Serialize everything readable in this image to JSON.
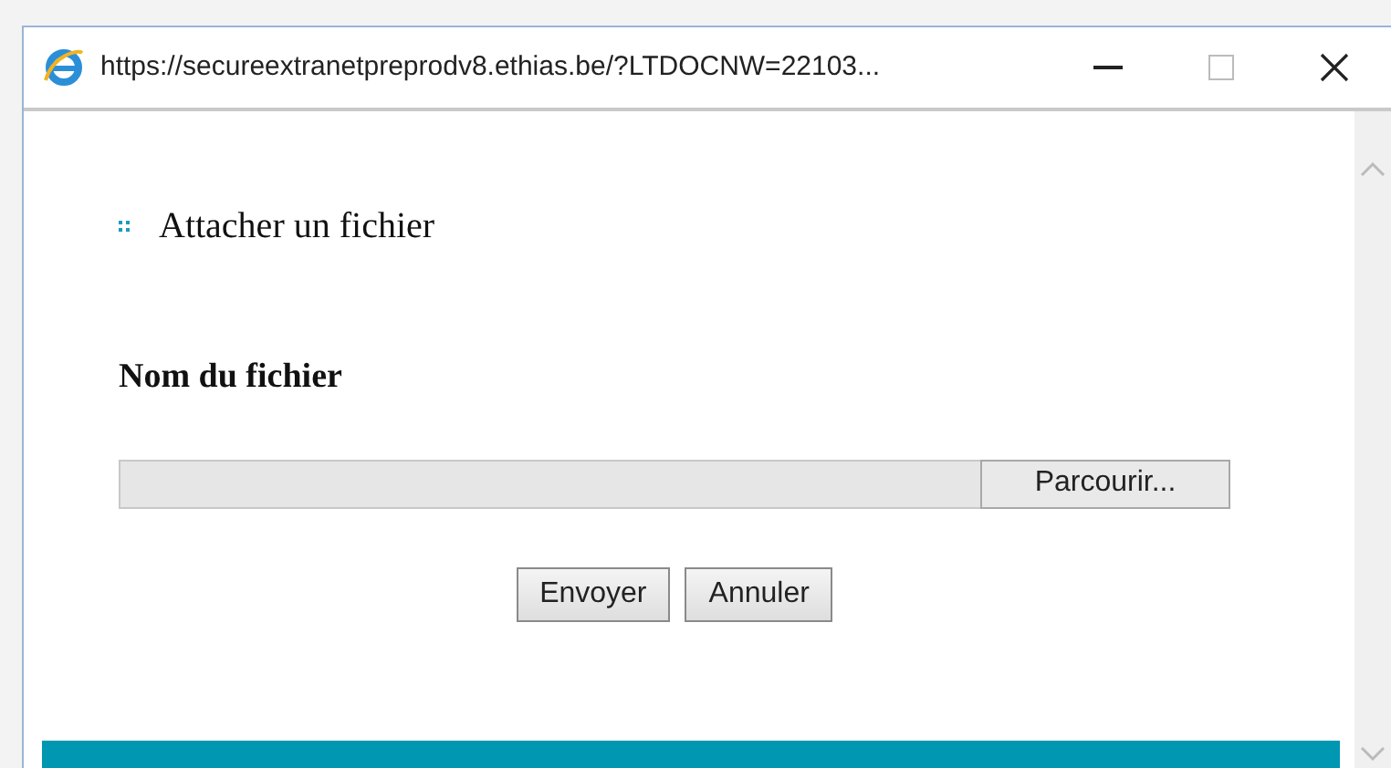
{
  "window": {
    "title": "https://secureextranetpreprodv8.ethias.be/?LTDOCNW=22103..."
  },
  "heading": "Attacher un fichier",
  "field_label": "Nom du fichier",
  "file_input": {
    "button": "Parcourir..."
  },
  "buttons": [
    "Envoyer",
    "Annuler"
  ]
}
